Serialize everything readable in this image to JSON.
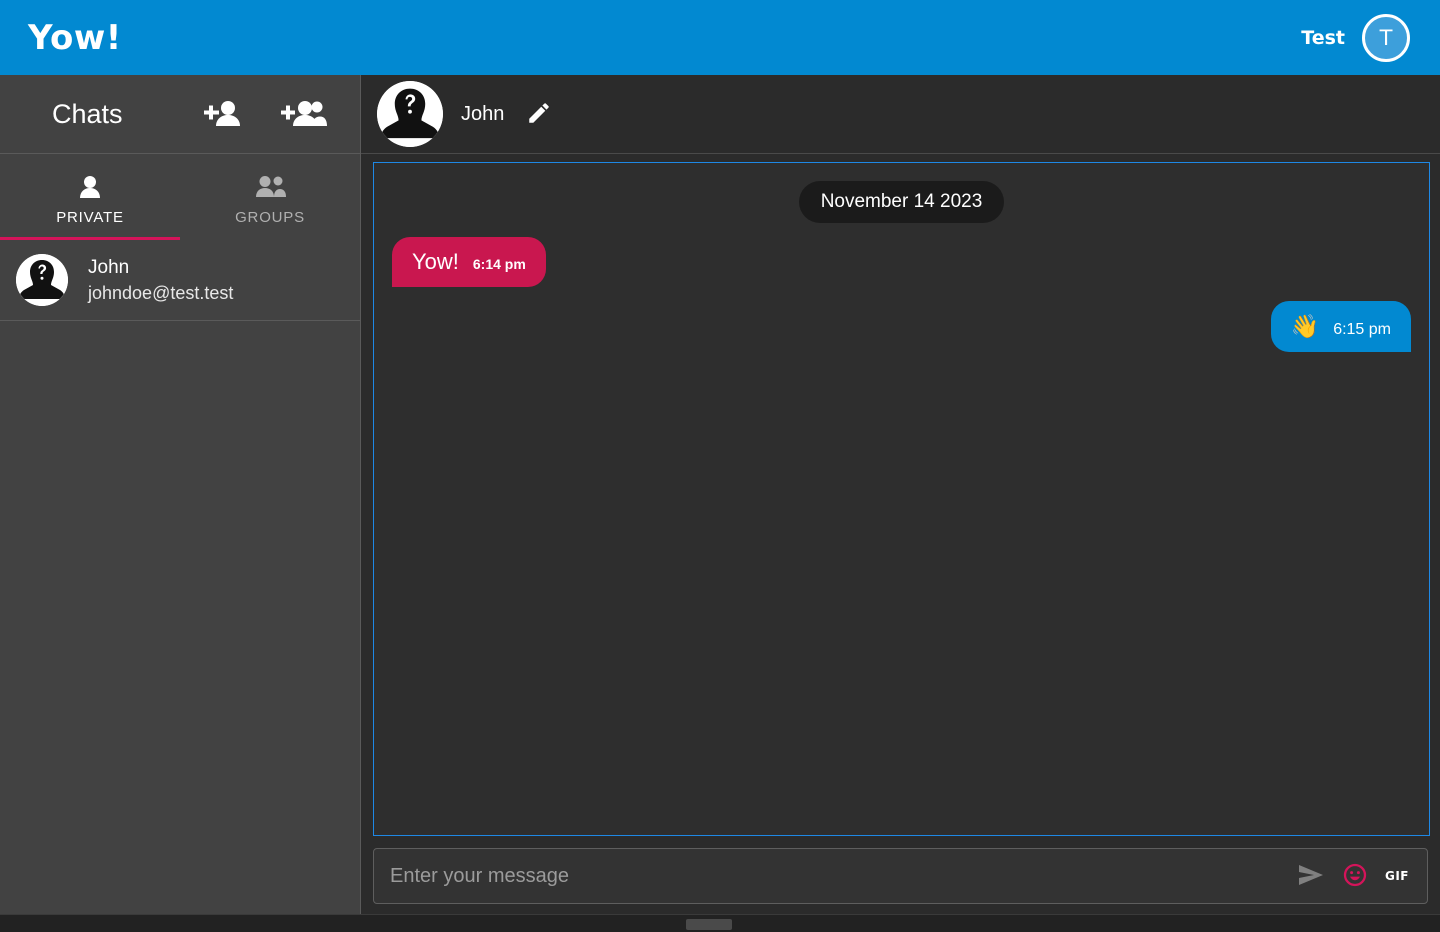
{
  "appbar": {
    "brand": "Yow!",
    "user_name": "Test",
    "avatar_initial": "T",
    "bg_color": "#0289d1"
  },
  "sidebar": {
    "title": "Chats",
    "add_contact_icon": "person-add-icon",
    "add_group_icon": "group-add-icon",
    "tabs": [
      {
        "label": "PRIVATE",
        "icon": "person-icon",
        "active": true
      },
      {
        "label": "GROUPS",
        "icon": "people-icon",
        "active": false
      }
    ],
    "active_tab_underline_color": "#d4145a",
    "chats": [
      {
        "name": "John",
        "email": "johndoe@test.test",
        "avatar": "mystery-person-avatar"
      }
    ]
  },
  "chat_header": {
    "contact_name": "John",
    "avatar": "mystery-person-avatar",
    "edit_icon": "pencil-edit-icon"
  },
  "conversation": {
    "date_separator": "November 14 2023",
    "messages": [
      {
        "direction": "in",
        "text": "Yow!",
        "time": "6:14 pm",
        "bubble_color": "#c9174f"
      },
      {
        "direction": "out",
        "text": "👋",
        "time": "6:15 pm",
        "bubble_color": "#0289d1"
      }
    ]
  },
  "composer": {
    "placeholder": "Enter your message",
    "value": "",
    "send_icon": "send-arrow-icon",
    "emoji_icon": "smiley-face-icon",
    "gif_label": "GIF",
    "emoji_color": "#d4145a"
  }
}
